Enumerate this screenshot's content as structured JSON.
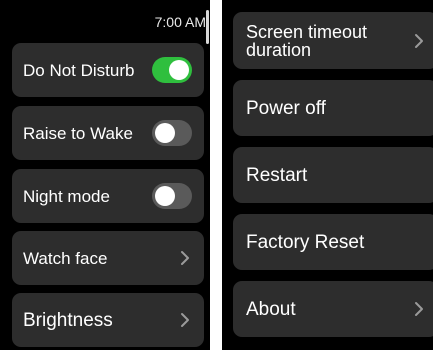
{
  "status": {
    "time": "7:00 AM"
  },
  "left_menu": {
    "items": [
      {
        "label": "Do Not Disturb",
        "control": "toggle",
        "state": "on"
      },
      {
        "label": "Raise to Wake",
        "control": "toggle",
        "state": "off"
      },
      {
        "label": "Night mode",
        "control": "toggle",
        "state": "off"
      },
      {
        "label": "Watch face",
        "control": "chevron"
      },
      {
        "label": "Brightness",
        "control": "chevron"
      }
    ]
  },
  "right_menu": {
    "items": [
      {
        "label": "Screen timeout\nduration",
        "control": "chevron"
      },
      {
        "label": "Power off"
      },
      {
        "label": "Restart"
      },
      {
        "label": "Factory Reset"
      },
      {
        "label": "About",
        "control": "chevron"
      }
    ]
  },
  "colors": {
    "card_background": "#2d2d2d",
    "toggle_on": "#2fbf3e",
    "toggle_off": "#5a5a5a"
  }
}
